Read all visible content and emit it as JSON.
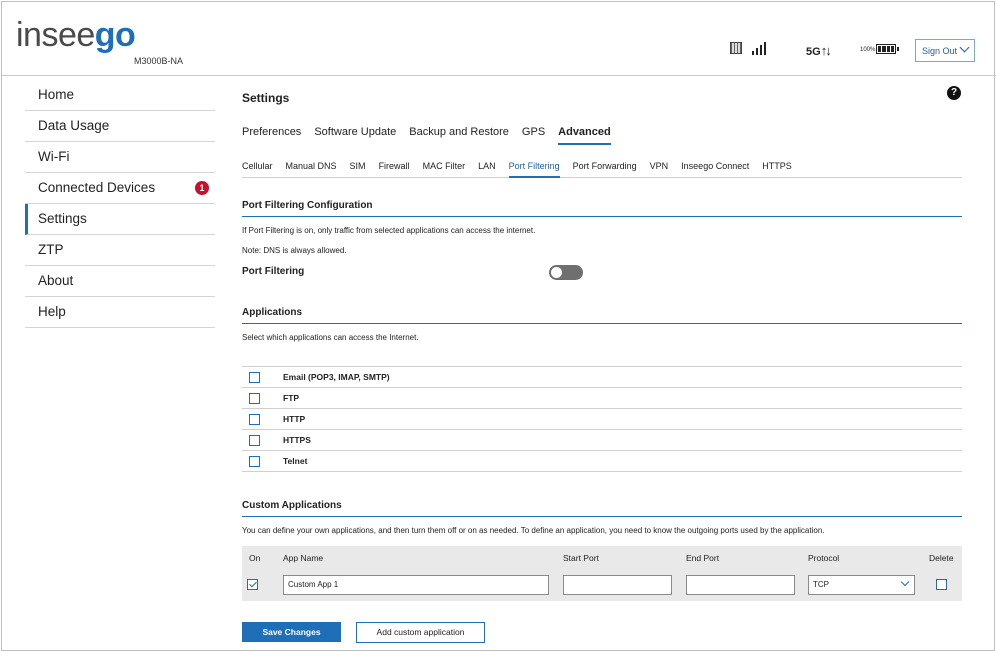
{
  "header": {
    "logo_prefix": "insee",
    "logo_suffix": "go",
    "model": "M3000B-NA",
    "network": "5G",
    "network_arrows": "↑↓",
    "battery_percent": "100%",
    "sign_out": "Sign Out"
  },
  "sidebar": {
    "items": [
      {
        "label": "Home"
      },
      {
        "label": "Data Usage"
      },
      {
        "label": "Wi-Fi"
      },
      {
        "label": "Connected Devices",
        "badge": "1"
      },
      {
        "label": "Settings"
      },
      {
        "label": "ZTP"
      },
      {
        "label": "About"
      },
      {
        "label": "Help"
      }
    ],
    "active": "Settings"
  },
  "main": {
    "title": "Settings",
    "help": "?",
    "tabs": [
      "Preferences",
      "Software Update",
      "Backup and Restore",
      "GPS",
      "Advanced"
    ],
    "active_tab": "Advanced",
    "subtabs": [
      "Cellular",
      "Manual DNS",
      "SIM",
      "Firewall",
      "MAC Filter",
      "LAN",
      "Port Filtering",
      "Port Forwarding",
      "VPN",
      "Inseego Connect",
      "HTTPS"
    ],
    "active_subtab": "Port Filtering"
  },
  "port_filtering": {
    "section_title": "Port Filtering Configuration",
    "description": "If Port Filtering is on, only traffic from selected applications can access the internet.",
    "note": "Note: DNS is always allowed.",
    "toggle_label": "Port Filtering",
    "enabled": false
  },
  "applications": {
    "section_title": "Applications",
    "description": "Select which applications can access the Internet.",
    "items": [
      {
        "name": "Email (POP3, IMAP, SMTP)",
        "checked": false
      },
      {
        "name": "FTP",
        "checked": false
      },
      {
        "name": "HTTP",
        "checked": false
      },
      {
        "name": "HTTPS",
        "checked": false
      },
      {
        "name": "Telnet",
        "checked": false
      }
    ]
  },
  "custom_applications": {
    "section_title": "Custom Applications",
    "description": "You can define your own applications, and then turn them off or on as needed. To define an application, you need to know the outgoing ports used by the application.",
    "columns": {
      "on": "On",
      "app_name": "App Name",
      "start_port": "Start Port",
      "end_port": "End Port",
      "protocol": "Protocol",
      "delete": "Delete"
    },
    "rows": [
      {
        "on": true,
        "app_name": "Custom App 1",
        "start_port": "",
        "end_port": "",
        "protocol": "TCP",
        "delete": false
      }
    ]
  },
  "buttons": {
    "save": "Save Changes",
    "add": "Add custom application"
  },
  "colors": {
    "accent": "#1f6fb8",
    "badge": "#c8102e"
  }
}
